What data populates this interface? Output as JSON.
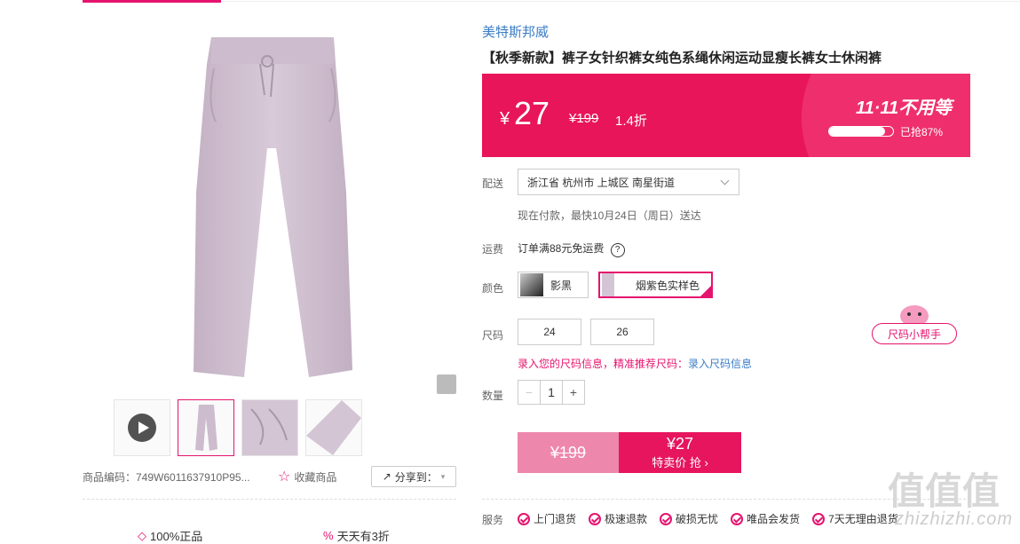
{
  "brand": "美特斯邦威",
  "title": "【秋季新款】裤子女针织裤女纯色系绳休闲运动显瘦长裤女士休闲裤",
  "price": {
    "currency": "¥",
    "current": "27",
    "original": "¥199",
    "discount": "1.4折",
    "event": "11·11不用等",
    "sold_text": "已抢87%",
    "sold_percent": 87
  },
  "delivery": {
    "label": "配送",
    "address": "浙江省 杭州市 上城区 南星街道",
    "eta": "现在付款，最快10月24日（周日）送达"
  },
  "shipping": {
    "label": "运费",
    "text": "订单满88元免运费",
    "help": "?"
  },
  "color": {
    "label": "颜色",
    "options": [
      "影黑",
      "烟紫色实样色"
    ]
  },
  "size": {
    "label": "尺码",
    "options": [
      "24",
      "26"
    ],
    "info_prefix": "录入您的尺码信息，精准推荐尺码：",
    "info_link": "录入尺码信息",
    "helper": "尺码小帮手"
  },
  "quantity": {
    "label": "数量",
    "value": "1",
    "minus": "−",
    "plus": "+"
  },
  "buy": {
    "original": "¥199",
    "price": "¥27",
    "sub": "特卖价 抢 ›"
  },
  "services": {
    "label": "服务",
    "items": [
      "上门退货",
      "极速退款",
      "破损无忧",
      "唯品会发货",
      "7天无理由退货"
    ]
  },
  "left": {
    "sku": "商品编码：749W6011637910P95...",
    "fav": "收藏商品",
    "share": "分享到：",
    "promise_1": "100%正品",
    "promise_2": "天天有3折"
  },
  "watermark": "zhizhizhi.com",
  "watermark_logo": "值值值",
  "colors": {
    "accent": "#e6136e",
    "banner": "#e8155a",
    "link": "#3a7cc5"
  }
}
